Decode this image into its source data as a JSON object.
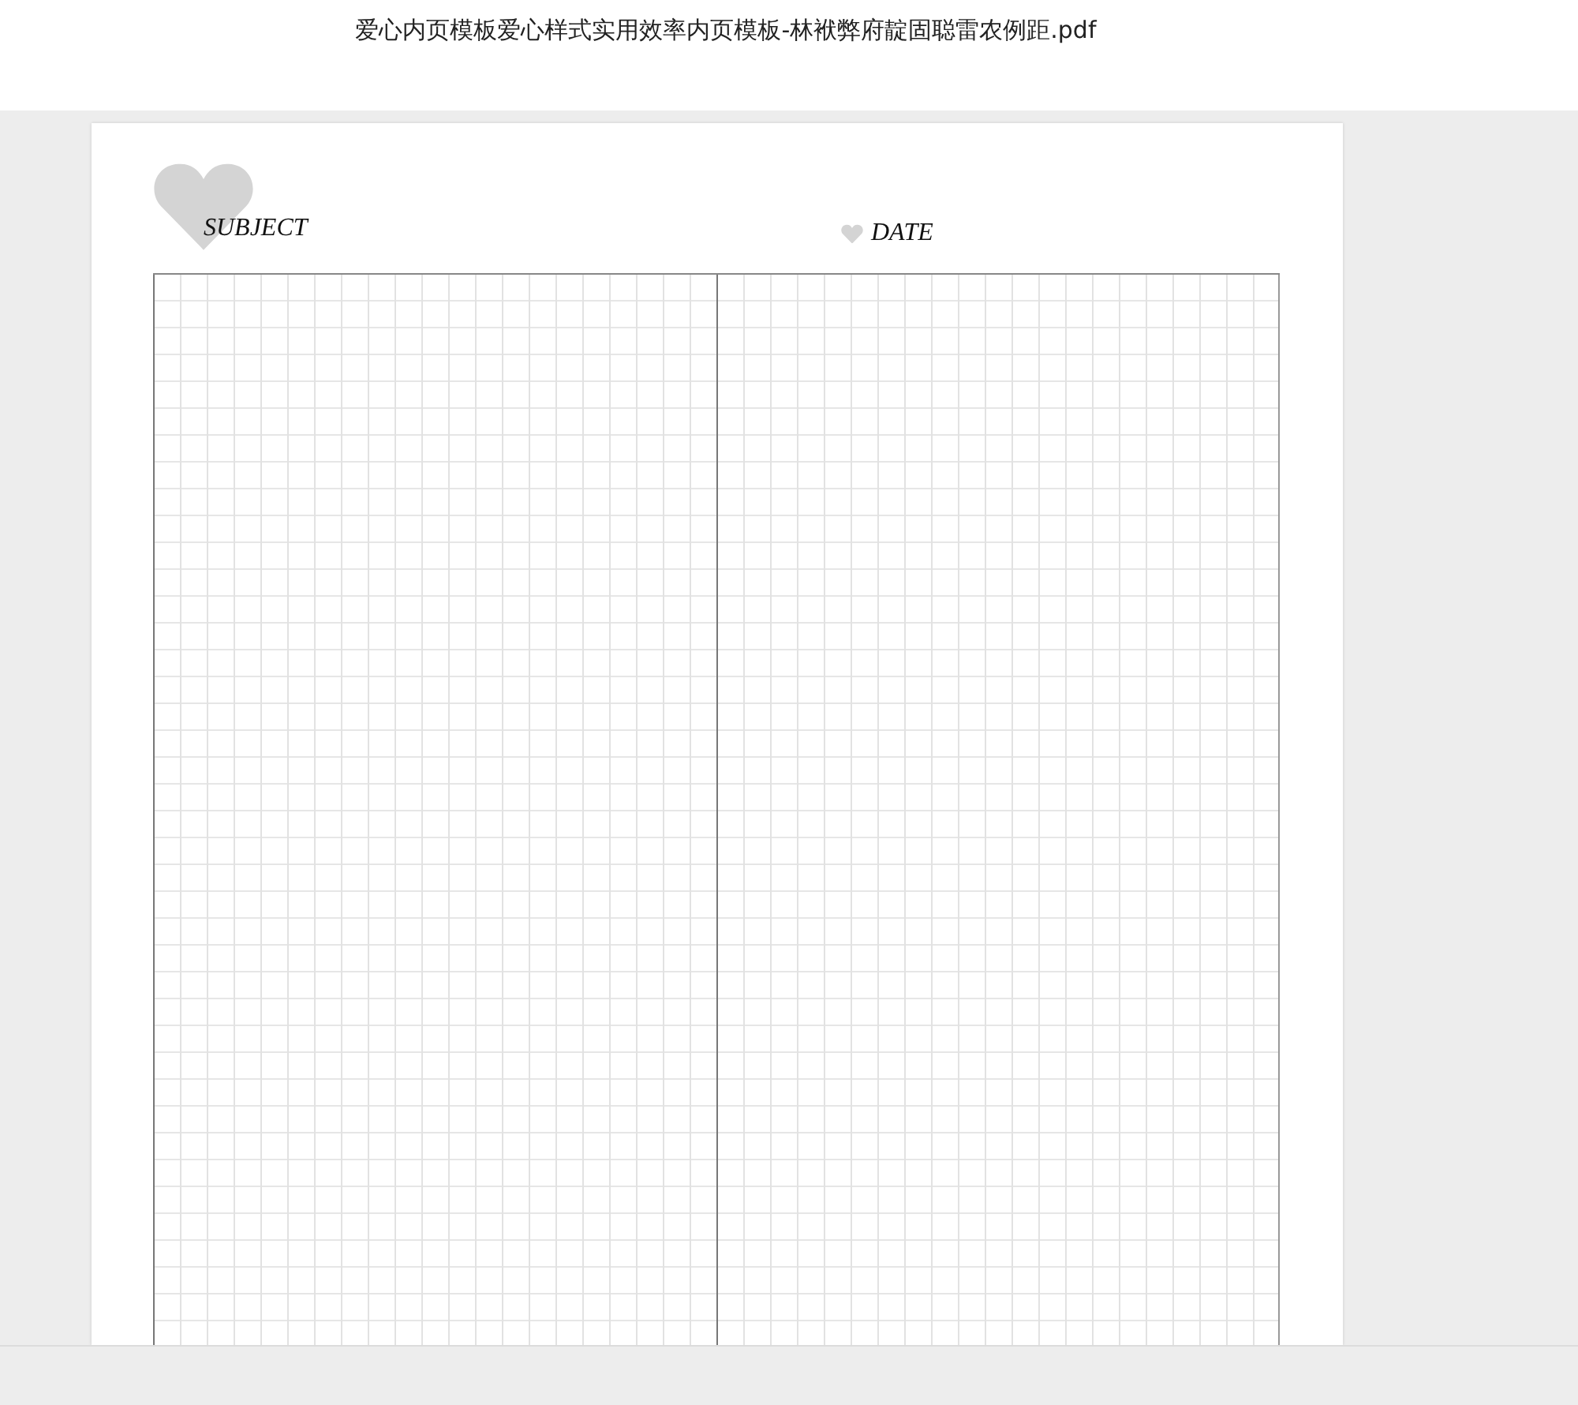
{
  "window": {
    "title": "爱心内页模板爱心样式实用效率内页模板-林袱弊府靛固聪雷农例距.pdf"
  },
  "page": {
    "subject_label": "SUBJECT",
    "date_label": "DATE"
  }
}
